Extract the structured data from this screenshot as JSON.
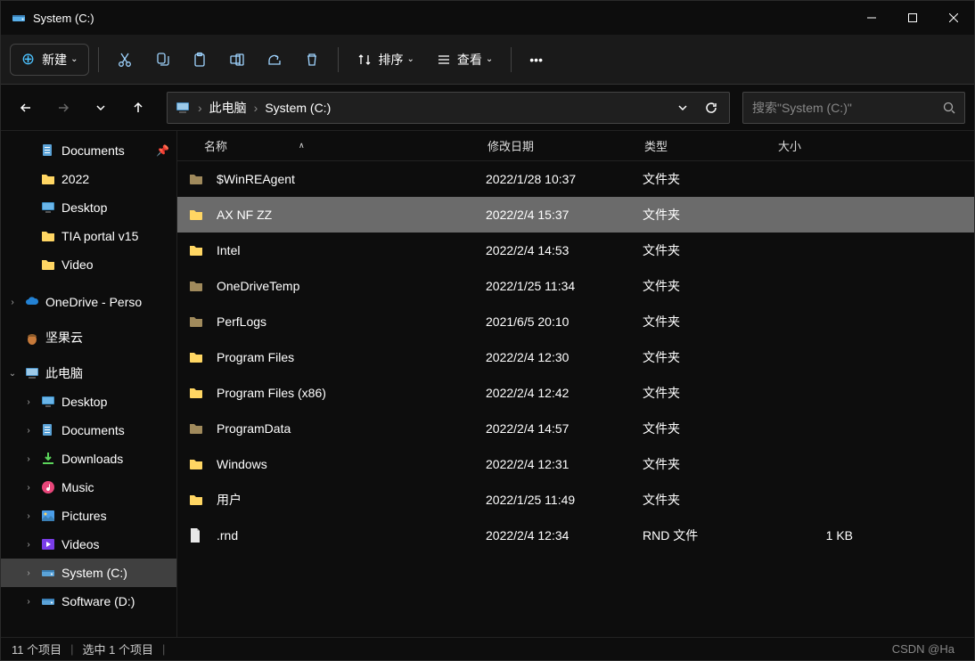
{
  "window": {
    "title": "System (C:)"
  },
  "toolbar": {
    "new_label": "新建",
    "sort_label": "排序",
    "view_label": "查看"
  },
  "navbar": {
    "breadcrumbs": [
      "此电脑",
      "System (C:)"
    ],
    "search_placeholder": "搜索\"System (C:)\""
  },
  "sidebar": {
    "quick": [
      {
        "label": "Documents",
        "icon": "documents",
        "pinned": true
      },
      {
        "label": "2022",
        "icon": "folder"
      },
      {
        "label": "Desktop",
        "icon": "desktop"
      },
      {
        "label": "TIA portal v15",
        "icon": "folder"
      },
      {
        "label": "Video",
        "icon": "folder"
      }
    ],
    "onedrive": {
      "label": "OneDrive - Perso",
      "expanded": false
    },
    "jianguo": {
      "label": "坚果云"
    },
    "thispc": {
      "label": "此电脑",
      "expanded": true,
      "children": [
        {
          "label": "Desktop",
          "icon": "desktop"
        },
        {
          "label": "Documents",
          "icon": "documents"
        },
        {
          "label": "Downloads",
          "icon": "downloads"
        },
        {
          "label": "Music",
          "icon": "music"
        },
        {
          "label": "Pictures",
          "icon": "pictures"
        },
        {
          "label": "Videos",
          "icon": "videos"
        },
        {
          "label": "System (C:)",
          "icon": "drive",
          "selected": true
        },
        {
          "label": "Software (D:)",
          "icon": "drive"
        }
      ]
    }
  },
  "headers": {
    "name": "名称",
    "date": "修改日期",
    "type": "类型",
    "size": "大小"
  },
  "files": [
    {
      "name": "$WinREAgent",
      "date": "2022/1/28 10:37",
      "type": "文件夹",
      "size": "",
      "icon": "folder-muted"
    },
    {
      "name": "AX NF ZZ",
      "date": "2022/2/4 15:37",
      "type": "文件夹",
      "size": "",
      "icon": "folder",
      "selected": true
    },
    {
      "name": "Intel",
      "date": "2022/2/4 14:53",
      "type": "文件夹",
      "size": "",
      "icon": "folder"
    },
    {
      "name": "OneDriveTemp",
      "date": "2022/1/25 11:34",
      "type": "文件夹",
      "size": "",
      "icon": "folder-muted"
    },
    {
      "name": "PerfLogs",
      "date": "2021/6/5 20:10",
      "type": "文件夹",
      "size": "",
      "icon": "folder-muted"
    },
    {
      "name": "Program Files",
      "date": "2022/2/4 12:30",
      "type": "文件夹",
      "size": "",
      "icon": "folder"
    },
    {
      "name": "Program Files (x86)",
      "date": "2022/2/4 12:42",
      "type": "文件夹",
      "size": "",
      "icon": "folder"
    },
    {
      "name": "ProgramData",
      "date": "2022/2/4 14:57",
      "type": "文件夹",
      "size": "",
      "icon": "folder-muted"
    },
    {
      "name": "Windows",
      "date": "2022/2/4 12:31",
      "type": "文件夹",
      "size": "",
      "icon": "folder"
    },
    {
      "name": "用户",
      "date": "2022/1/25 11:49",
      "type": "文件夹",
      "size": "",
      "icon": "folder"
    },
    {
      "name": ".rnd",
      "date": "2022/2/4 12:34",
      "type": "RND 文件",
      "size": "1 KB",
      "icon": "file"
    }
  ],
  "status": {
    "count": "11 个项目",
    "selected": "选中 1 个项目"
  },
  "watermark": "CSDN @Ha"
}
